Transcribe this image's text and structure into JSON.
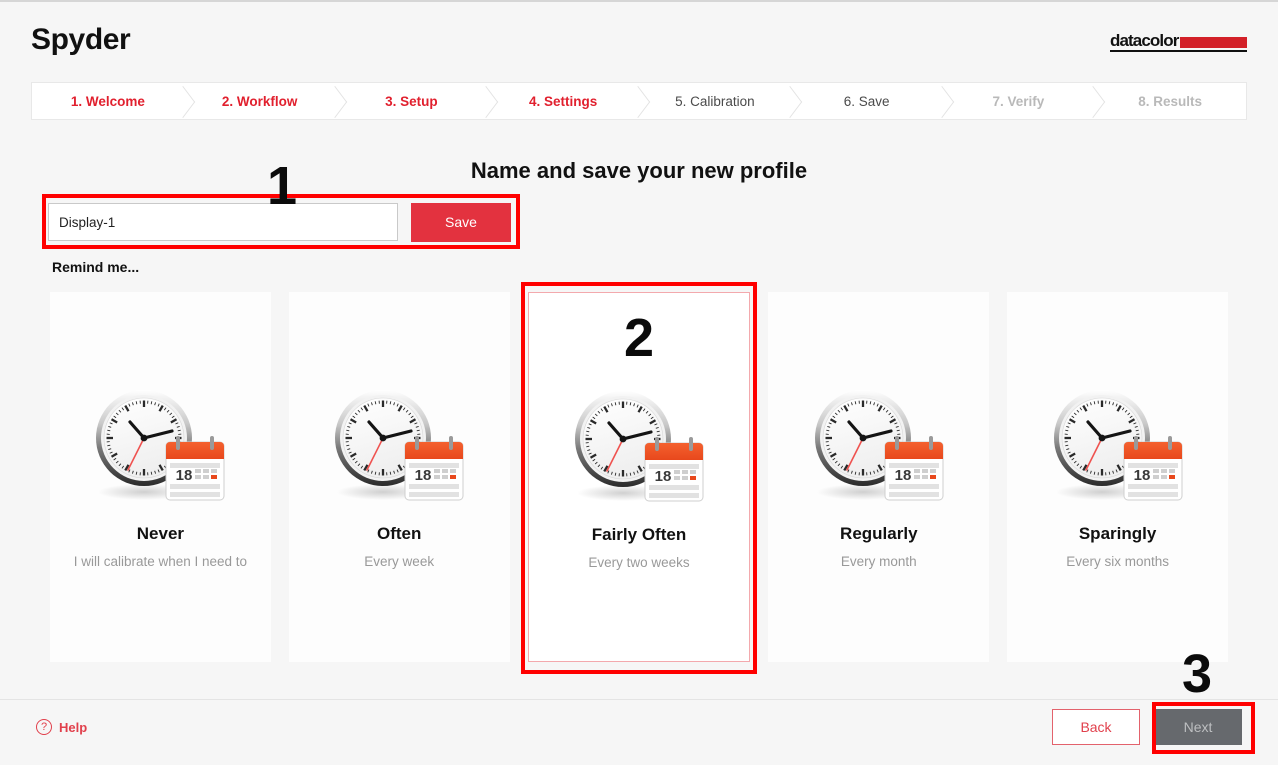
{
  "app": {
    "title": "Spyder",
    "logo_word": "datacolor",
    "logo_bar_color": "#d32028"
  },
  "steps": [
    {
      "label": "1. Welcome",
      "state": "active"
    },
    {
      "label": "2. Workflow",
      "state": "active"
    },
    {
      "label": "3. Setup",
      "state": "active"
    },
    {
      "label": "4. Settings",
      "state": "active"
    },
    {
      "label": "5. Calibration",
      "state": "plain"
    },
    {
      "label": "6. Save",
      "state": "plain"
    },
    {
      "label": "7. Verify",
      "state": "muted"
    },
    {
      "label": "8. Results",
      "state": "muted"
    }
  ],
  "main": {
    "section_title": "Name and save your new profile",
    "profile_name": {
      "value": "Display-1",
      "placeholder": "Display-1"
    },
    "save_label": "Save",
    "remind_label": "Remind me...",
    "reminder_options": [
      {
        "name": "Never",
        "sub": "I will calibrate when I need to",
        "badge": "",
        "selected": false
      },
      {
        "name": "Often",
        "sub": "Every week",
        "badge": "",
        "selected": false
      },
      {
        "name": "Fairly Often",
        "sub": "Every two weeks",
        "badge": "2",
        "selected": true
      },
      {
        "name": "Regularly",
        "sub": "Every month",
        "badge": "",
        "selected": false
      },
      {
        "name": "Sparingly",
        "sub": "Every six months",
        "badge": "",
        "selected": false
      }
    ],
    "calendar_day": "18"
  },
  "footer": {
    "help_label": "Help",
    "help_glyph": "?",
    "back_label": "Back",
    "next_label": "Next"
  },
  "annotations": {
    "one": "1",
    "three": "3",
    "color": "#ff0000"
  },
  "colors": {
    "accent_red": "#e1202e",
    "save_red": "#e3323f",
    "muted_gray": "#b9b9b9",
    "page_bg": "#f6f6f6",
    "next_disabled": "#66696d"
  }
}
